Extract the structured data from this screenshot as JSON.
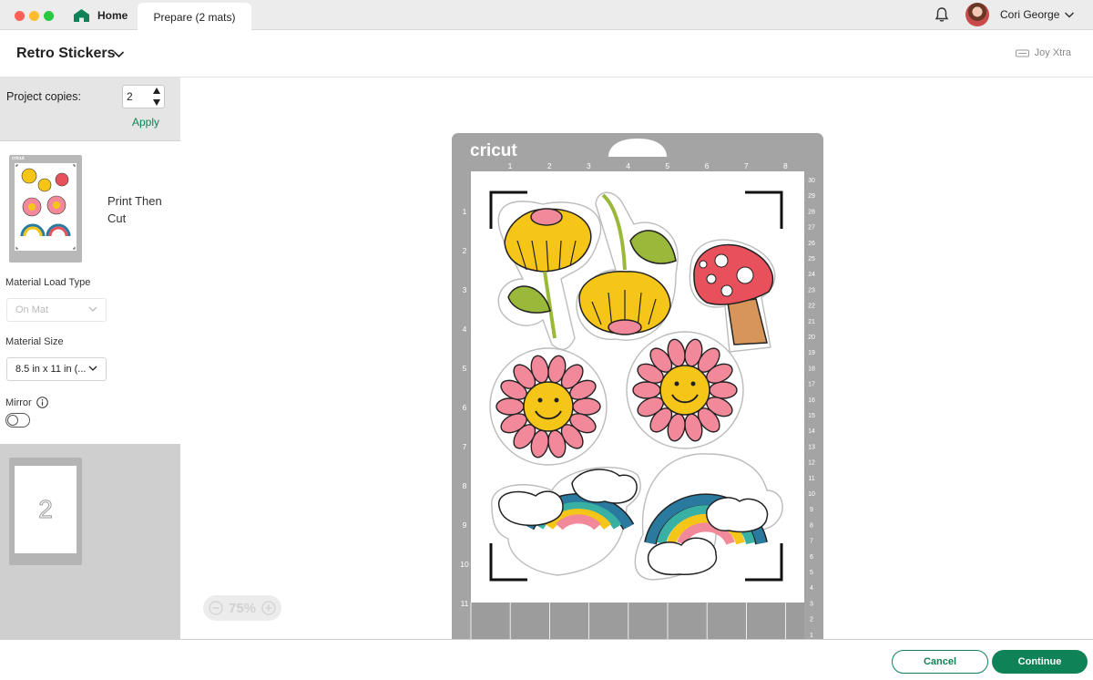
{
  "tabs": {
    "home_label": "Home",
    "active_label": "Prepare (2 mats)"
  },
  "user": {
    "name": "Cori George"
  },
  "header": {
    "project_title": "Retro Stickers",
    "machine": "Joy Xtra"
  },
  "sidebar": {
    "copies_label": "Project copies:",
    "copies_value": "2",
    "apply_label": "Apply",
    "mats": [
      {
        "cricut_mark": "cricut",
        "label": "Print Then Cut"
      },
      {
        "number": "2"
      }
    ],
    "load_type_label": "Material Load Type",
    "load_type_value": "On Mat",
    "size_label": "Material Size",
    "size_value": "8.5 in x 11 in (...",
    "mirror_label": "Mirror",
    "mirror_on": false
  },
  "mat": {
    "brand": "cricut",
    "top_ruler": [
      "1",
      "2",
      "3",
      "4",
      "5",
      "6",
      "7",
      "8"
    ],
    "left_ruler": [
      "1",
      "2",
      "3",
      "4",
      "5",
      "6",
      "7",
      "8",
      "9",
      "10",
      "11"
    ],
    "right_ruler": [
      "30",
      "29",
      "28",
      "27",
      "26",
      "25",
      "24",
      "23",
      "22",
      "21",
      "20",
      "19",
      "18",
      "17",
      "16",
      "15",
      "14",
      "13",
      "12",
      "11",
      "10",
      "9",
      "8",
      "7",
      "6",
      "5",
      "4",
      "3",
      "2",
      "1"
    ]
  },
  "zoom": {
    "level": "75%"
  },
  "footer": {
    "cancel_label": "Cancel",
    "continue_label": "Continue"
  },
  "colors": {
    "brand_green": "#108257",
    "mat_gray": "#a4a4a4"
  },
  "icons": [
    "home-icon",
    "bell-icon",
    "chevron-down-icon",
    "machine-icon",
    "info-icon",
    "zoom-out-icon",
    "zoom-in-icon",
    "stepper-up-icon",
    "stepper-down-icon"
  ]
}
